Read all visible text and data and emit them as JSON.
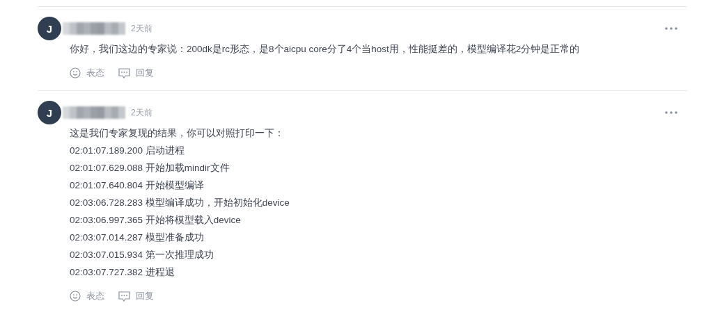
{
  "comments": [
    {
      "avatar_initial": "J",
      "time": "2天前",
      "lines": [
        "你好，我们这边的专家说：200dk是rc形态，是8个aicpu core分了4个当host用，性能挺差的，模型编译花2分钟是正常的"
      ],
      "actions": [
        {
          "kind": "react",
          "label": "表态"
        },
        {
          "kind": "reply",
          "label": "回复"
        }
      ]
    },
    {
      "avatar_initial": "J",
      "time": "2天前",
      "lines": [
        "这是我们专家复现的结果，你可以对照打印一下：",
        "02:01:07.189.200 启动进程",
        "02:01:07.629.088 开始加载mindir文件",
        "02:01:07.640.804 开始模型编译",
        "02:03:06.728.283 模型编译成功，开始初始化device",
        "02:03:06.997.365 开始将模型载入device",
        "02:03:07.014.287 模型准备成功",
        "02:03:07.015.934 第一次推理成功",
        "02:03:07.727.382 进程退"
      ],
      "actions": [
        {
          "kind": "react",
          "label": "表态"
        },
        {
          "kind": "reply",
          "label": "回复"
        }
      ]
    }
  ]
}
